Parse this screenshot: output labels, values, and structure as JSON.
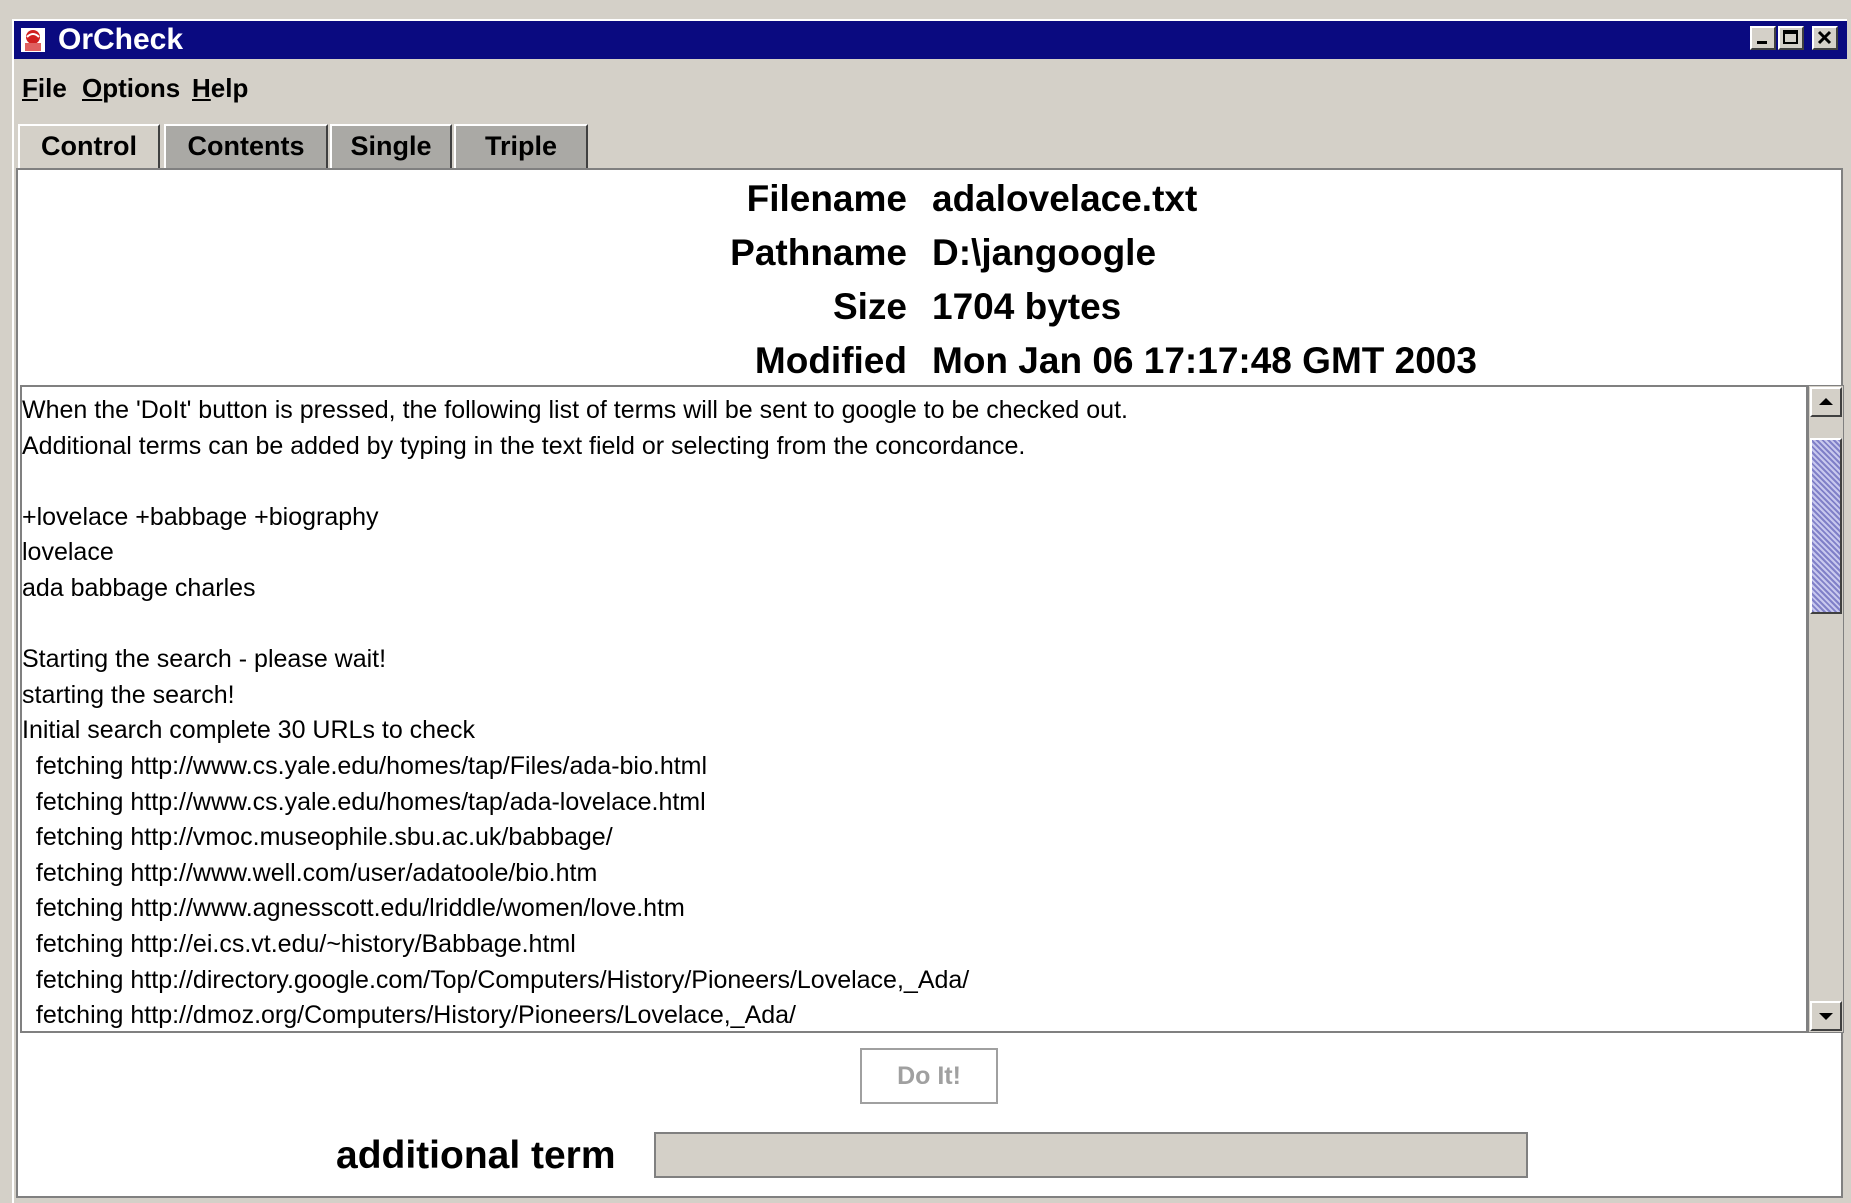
{
  "window": {
    "title": "OrCheck",
    "icon": "app-icon"
  },
  "menubar": {
    "items": [
      {
        "mnemonic": "F",
        "rest": "ile"
      },
      {
        "mnemonic": "O",
        "rest": "ptions"
      },
      {
        "mnemonic": "H",
        "rest": "elp"
      }
    ]
  },
  "tabs": {
    "control": "Control",
    "contents": "Contents",
    "single": "Single",
    "triple": "Triple",
    "selected": "Control"
  },
  "fileinfo": {
    "filename_label": "Filename",
    "filename": "adalovelace.txt",
    "pathname_label": "Pathname",
    "pathname": "D:\\jangoogle",
    "size_label": "Size",
    "size": "1704 bytes",
    "modified_label": "Modified",
    "modified": "Mon Jan 06 17:17:48 GMT 2003"
  },
  "log": {
    "lines": [
      "When the 'DoIt' button is pressed, the following list of terms will be sent to google to be checked out.",
      "Additional terms can be added by typing in the text field or selecting from the concordance.",
      "",
      "+lovelace +babbage +biography",
      "lovelace",
      "ada babbage charles",
      "",
      "Starting the search - please wait!",
      "starting the search!",
      "Initial search complete 30 URLs to check",
      "  fetching http://www.cs.yale.edu/homes/tap/Files/ada-bio.html",
      "  fetching http://www.cs.yale.edu/homes/tap/ada-lovelace.html",
      "  fetching http://vmoc.museophile.sbu.ac.uk/babbage/",
      "  fetching http://www.well.com/user/adatoole/bio.htm",
      "  fetching http://www.agnesscott.edu/lriddle/women/love.htm",
      "  fetching http://ei.cs.vt.edu/~history/Babbage.html",
      "  fetching http://directory.google.com/Top/Computers/History/Pioneers/Lovelace,_Ada/",
      "  fetching http://dmoz.org/Computers/History/Pioneers/Lovelace,_Ada/"
    ],
    "scroll_position": 0.05
  },
  "actions": {
    "doit_label": "Do It!",
    "doit_enabled": false
  },
  "additional": {
    "label": "additional term",
    "value": ""
  }
}
